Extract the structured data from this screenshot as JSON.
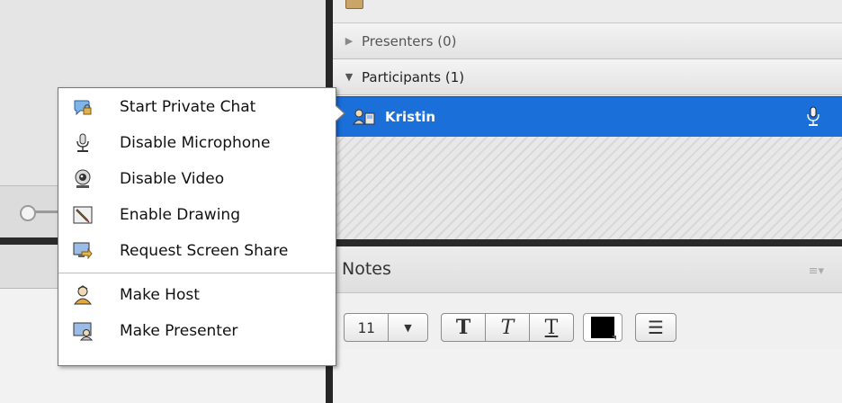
{
  "context_menu": {
    "items": [
      {
        "label": "Start Private Chat",
        "icon": "chat-bubble-lock-icon"
      },
      {
        "label": "Disable Microphone",
        "icon": "microphone-icon"
      },
      {
        "label": "Disable Video",
        "icon": "webcam-icon"
      },
      {
        "label": "Enable Drawing",
        "icon": "pencil-icon"
      },
      {
        "label": "Request Screen Share",
        "icon": "screen-share-icon"
      },
      {
        "label": "Make Host",
        "icon": "host-user-icon"
      },
      {
        "label": "Make Presenter",
        "icon": "presenter-icon"
      }
    ]
  },
  "attendees": {
    "presenters_label": "Presenters (0)",
    "participants_label": "Participants (1)",
    "participants": [
      {
        "name": "Kristin",
        "icon": "user-icon",
        "status_icon": "microphone-icon"
      }
    ]
  },
  "notes": {
    "title": "Notes",
    "font_size": "11",
    "bold_glyph": "T",
    "italic_glyph": "T",
    "underline_glyph": "T",
    "text_color": "#000000",
    "list_glyph": "☰"
  },
  "colors": {
    "selection": "#1a6fd8",
    "divider": "#262626"
  }
}
